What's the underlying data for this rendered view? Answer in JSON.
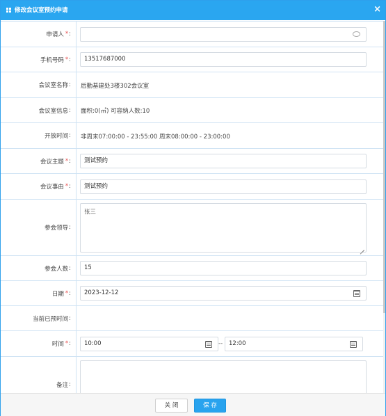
{
  "dialog": {
    "title": "修改会议室预约申请",
    "close_symbol": "×"
  },
  "fields": {
    "applicant": {
      "label": "申请人",
      "required_mark": "*",
      "colon": ":",
      "value": ""
    },
    "phone": {
      "label": "手机号码",
      "required_mark": "*",
      "colon": ":",
      "value": "13517687000"
    },
    "room_name": {
      "label": "会议室名称",
      "colon": ":",
      "value": "后勤基建处3楼302会议室"
    },
    "room_info": {
      "label": "会议室信息",
      "colon": ":",
      "value": "面积:0(㎡) 可容纳人数:10"
    },
    "open_time": {
      "label": "开放时间",
      "colon": ":",
      "value": "非周末07:00:00 - 23:55:00 周末08:00:00 - 23:00:00"
    },
    "topic": {
      "label": "会议主题",
      "required_mark": "*",
      "colon": ":",
      "value": "测试预约"
    },
    "reason": {
      "label": "会议事由",
      "required_mark": "*",
      "colon": ":",
      "value": "测试预约"
    },
    "leader": {
      "label": "参会领导",
      "colon": ":",
      "value": "张三"
    },
    "attendees": {
      "label": "参会人数",
      "colon": ":",
      "value": "15"
    },
    "date": {
      "label": "日期",
      "required_mark": "*",
      "colon": ":",
      "value": "2023-12-12"
    },
    "booked_times": {
      "label": "当前已预时间",
      "colon": ":",
      "value": ""
    },
    "time": {
      "label": "时间",
      "required_mark": "*",
      "colon": ":",
      "start": "10:00",
      "end": "12:00",
      "separator": "--"
    },
    "remark": {
      "label": "备注",
      "colon": ":",
      "value": ""
    }
  },
  "footer": {
    "close_label": "关 闭",
    "save_label": "保 存"
  },
  "icons": {
    "title": "grid-icon",
    "applicant_picker": "chat-bubble-icon",
    "date_picker": "calendar-icon"
  },
  "colors": {
    "titlebar": "#2aa6f0",
    "required": "#e64b4b",
    "save_button": "#29a3ee"
  }
}
